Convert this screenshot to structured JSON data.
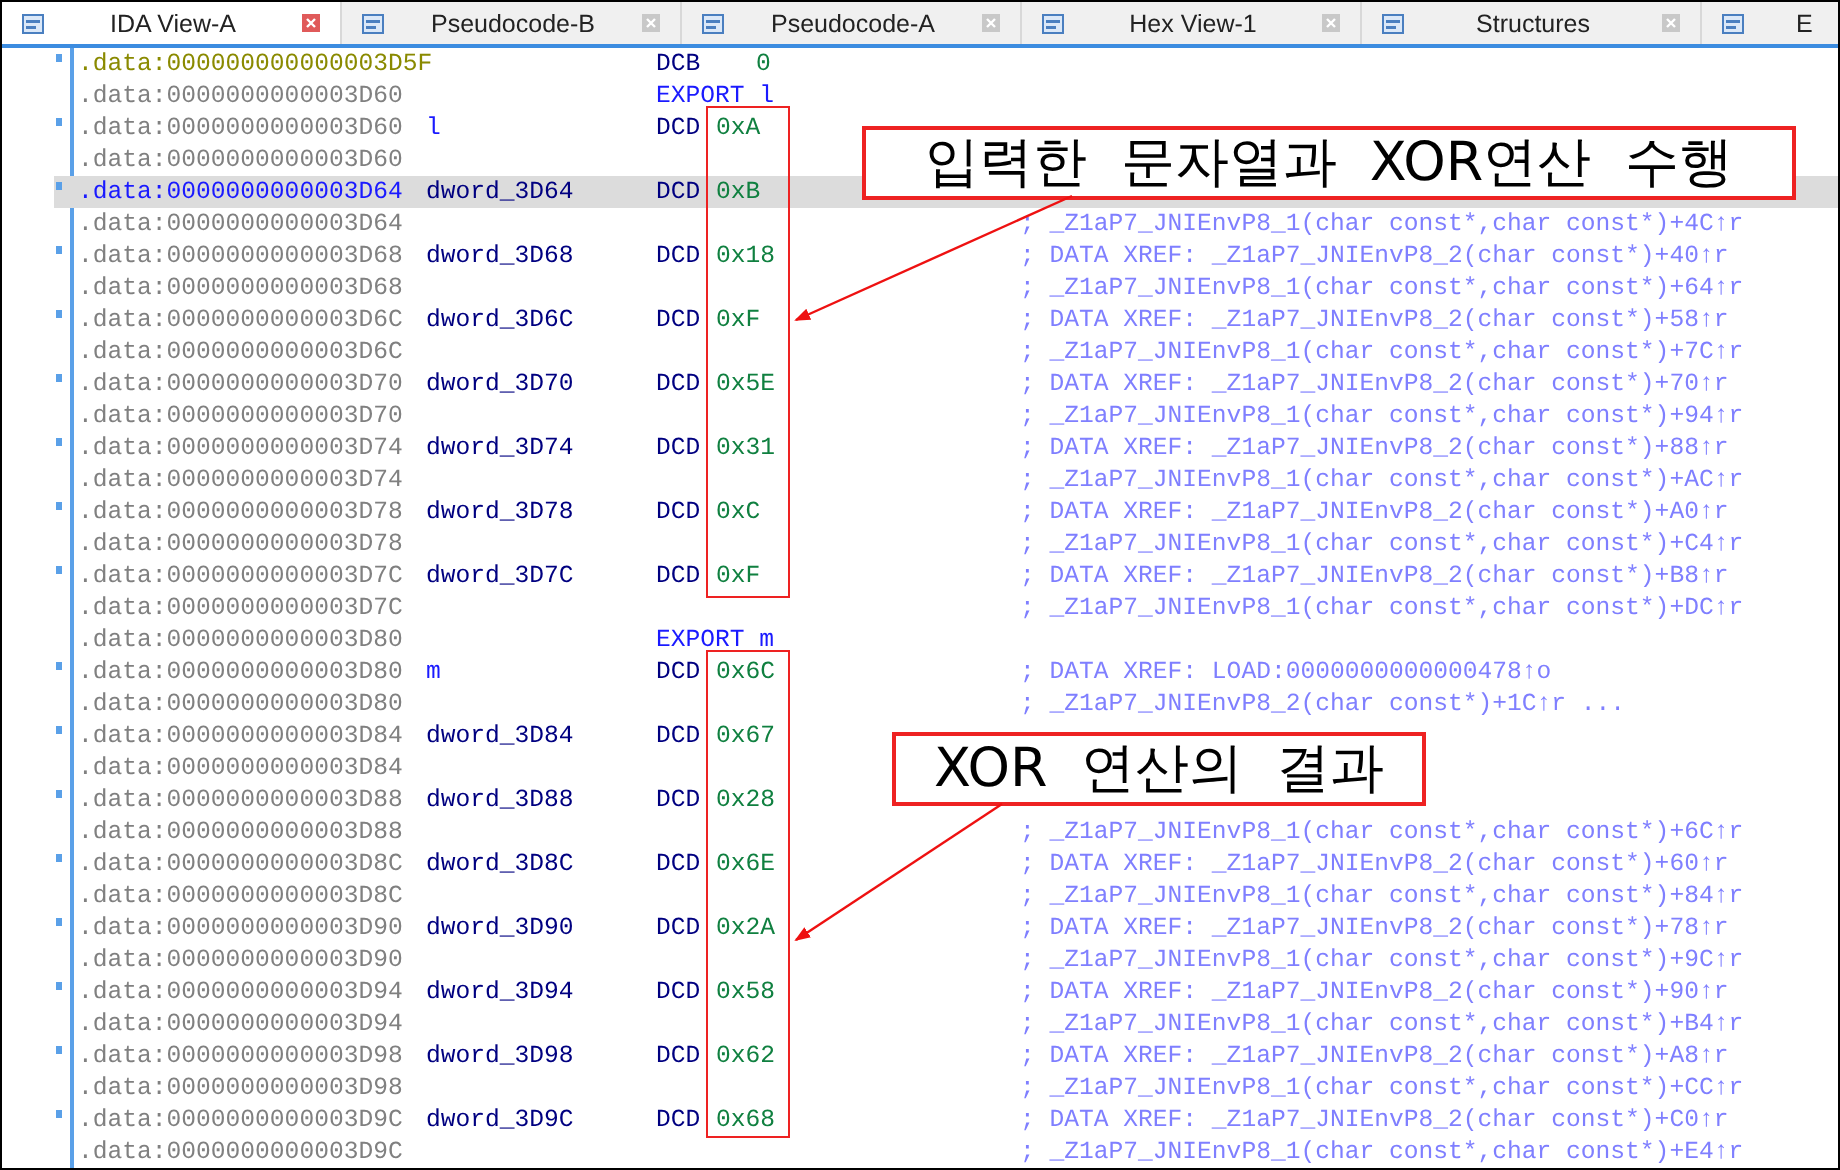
{
  "tabs": [
    {
      "label": "IDA View-A",
      "selected": true,
      "closable": true
    },
    {
      "label": "Pseudocode-B",
      "selected": false,
      "closable": true
    },
    {
      "label": "Pseudocode-A",
      "selected": false,
      "closable": true
    },
    {
      "label": "Hex View-1",
      "selected": false,
      "closable": true
    },
    {
      "label": "Structures",
      "selected": false,
      "closable": true
    },
    {
      "label": "E",
      "selected": false,
      "closable": false
    }
  ],
  "listing": [
    {
      "kind": "data",
      "dot": true,
      "unexplored": true,
      "selected": false,
      "address": ".data:000000000000003D5F",
      "op": "DCB",
      "operand": "0"
    },
    {
      "kind": "export",
      "dot": false,
      "unexplored": false,
      "selected": false,
      "address": ".data:0000000000003D60",
      "op": "EXPORT",
      "operand": "l"
    },
    {
      "kind": "data",
      "dot": true,
      "unexplored": false,
      "selected": false,
      "address": ".data:0000000000003D60",
      "label": "l",
      "public": true,
      "op": "DCD",
      "operand": "0xA"
    },
    {
      "kind": "data",
      "dot": false,
      "unexplored": false,
      "selected": false,
      "address": ".data:0000000000003D60"
    },
    {
      "kind": "data",
      "dot": true,
      "unexplored": false,
      "selected": true,
      "address": ".data:0000000000003D64",
      "label": "dword_3D64",
      "public": false,
      "op": "DCD",
      "operand": "0xB"
    },
    {
      "kind": "data",
      "dot": false,
      "unexplored": false,
      "selected": false,
      "address": ".data:0000000000003D64",
      "comment": "; _Z1aP7_JNIEnvP8_1(char const*,char const*)+4C↑r"
    },
    {
      "kind": "data",
      "dot": true,
      "unexplored": false,
      "selected": false,
      "address": ".data:0000000000003D68",
      "label": "dword_3D68",
      "public": false,
      "op": "DCD",
      "operand": "0x18",
      "comment": "; DATA XREF: _Z1aP7_JNIEnvP8_2(char const*)+40↑r"
    },
    {
      "kind": "data",
      "dot": false,
      "unexplored": false,
      "selected": false,
      "address": ".data:0000000000003D68",
      "comment": "; _Z1aP7_JNIEnvP8_1(char const*,char const*)+64↑r"
    },
    {
      "kind": "data",
      "dot": true,
      "unexplored": false,
      "selected": false,
      "address": ".data:0000000000003D6C",
      "label": "dword_3D6C",
      "public": false,
      "op": "DCD",
      "operand": "0xF",
      "comment": "; DATA XREF: _Z1aP7_JNIEnvP8_2(char const*)+58↑r"
    },
    {
      "kind": "data",
      "dot": false,
      "unexplored": false,
      "selected": false,
      "address": ".data:0000000000003D6C",
      "comment": "; _Z1aP7_JNIEnvP8_1(char const*,char const*)+7C↑r"
    },
    {
      "kind": "data",
      "dot": true,
      "unexplored": false,
      "selected": false,
      "address": ".data:0000000000003D70",
      "label": "dword_3D70",
      "public": false,
      "op": "DCD",
      "operand": "0x5E",
      "comment": "; DATA XREF: _Z1aP7_JNIEnvP8_2(char const*)+70↑r"
    },
    {
      "kind": "data",
      "dot": false,
      "unexplored": false,
      "selected": false,
      "address": ".data:0000000000003D70",
      "comment": "; _Z1aP7_JNIEnvP8_1(char const*,char const*)+94↑r"
    },
    {
      "kind": "data",
      "dot": true,
      "unexplored": false,
      "selected": false,
      "address": ".data:0000000000003D74",
      "label": "dword_3D74",
      "public": false,
      "op": "DCD",
      "operand": "0x31",
      "comment": "; DATA XREF: _Z1aP7_JNIEnvP8_2(char const*)+88↑r"
    },
    {
      "kind": "data",
      "dot": false,
      "unexplored": false,
      "selected": false,
      "address": ".data:0000000000003D74",
      "comment": "; _Z1aP7_JNIEnvP8_1(char const*,char const*)+AC↑r"
    },
    {
      "kind": "data",
      "dot": true,
      "unexplored": false,
      "selected": false,
      "address": ".data:0000000000003D78",
      "label": "dword_3D78",
      "public": false,
      "op": "DCD",
      "operand": "0xC",
      "comment": "; DATA XREF: _Z1aP7_JNIEnvP8_2(char const*)+A0↑r"
    },
    {
      "kind": "data",
      "dot": false,
      "unexplored": false,
      "selected": false,
      "address": ".data:0000000000003D78",
      "comment": "; _Z1aP7_JNIEnvP8_1(char const*,char const*)+C4↑r"
    },
    {
      "kind": "data",
      "dot": true,
      "unexplored": false,
      "selected": false,
      "address": ".data:0000000000003D7C",
      "label": "dword_3D7C",
      "public": false,
      "op": "DCD",
      "operand": "0xF",
      "comment": "; DATA XREF: _Z1aP7_JNIEnvP8_2(char const*)+B8↑r"
    },
    {
      "kind": "data",
      "dot": false,
      "unexplored": false,
      "selected": false,
      "address": ".data:0000000000003D7C",
      "comment": "; _Z1aP7_JNIEnvP8_1(char const*,char const*)+DC↑r"
    },
    {
      "kind": "export",
      "dot": false,
      "unexplored": false,
      "selected": false,
      "address": ".data:0000000000003D80",
      "op": "EXPORT",
      "operand": "m"
    },
    {
      "kind": "data",
      "dot": true,
      "unexplored": false,
      "selected": false,
      "address": ".data:0000000000003D80",
      "label": "m",
      "public": true,
      "op": "DCD",
      "operand": "0x6C",
      "comment": "; DATA XREF: LOAD:0000000000000478↑o"
    },
    {
      "kind": "data",
      "dot": false,
      "unexplored": false,
      "selected": false,
      "address": ".data:0000000000003D80",
      "comment": "; _Z1aP7_JNIEnvP8_2(char const*)+1C↑r ..."
    },
    {
      "kind": "data",
      "dot": true,
      "unexplored": false,
      "selected": false,
      "address": ".data:0000000000003D84",
      "label": "dword_3D84",
      "public": false,
      "op": "DCD",
      "operand": "0x67"
    },
    {
      "kind": "data",
      "dot": false,
      "unexplored": false,
      "selected": false,
      "address": ".data:0000000000003D84"
    },
    {
      "kind": "data",
      "dot": true,
      "unexplored": false,
      "selected": false,
      "address": ".data:0000000000003D88",
      "label": "dword_3D88",
      "public": false,
      "op": "DCD",
      "operand": "0x28"
    },
    {
      "kind": "data",
      "dot": false,
      "unexplored": false,
      "selected": false,
      "address": ".data:0000000000003D88",
      "comment": "; _Z1aP7_JNIEnvP8_1(char const*,char const*)+6C↑r"
    },
    {
      "kind": "data",
      "dot": true,
      "unexplored": false,
      "selected": false,
      "address": ".data:0000000000003D8C",
      "label": "dword_3D8C",
      "public": false,
      "op": "DCD",
      "operand": "0x6E",
      "comment": "; DATA XREF: _Z1aP7_JNIEnvP8_2(char const*)+60↑r"
    },
    {
      "kind": "data",
      "dot": false,
      "unexplored": false,
      "selected": false,
      "address": ".data:0000000000003D8C",
      "comment": "; _Z1aP7_JNIEnvP8_1(char const*,char const*)+84↑r"
    },
    {
      "kind": "data",
      "dot": true,
      "unexplored": false,
      "selected": false,
      "address": ".data:0000000000003D90",
      "label": "dword_3D90",
      "public": false,
      "op": "DCD",
      "operand": "0x2A",
      "comment": "; DATA XREF: _Z1aP7_JNIEnvP8_2(char const*)+78↑r"
    },
    {
      "kind": "data",
      "dot": false,
      "unexplored": false,
      "selected": false,
      "address": ".data:0000000000003D90",
      "comment": "; _Z1aP7_JNIEnvP8_1(char const*,char const*)+9C↑r"
    },
    {
      "kind": "data",
      "dot": true,
      "unexplored": false,
      "selected": false,
      "address": ".data:0000000000003D94",
      "label": "dword_3D94",
      "public": false,
      "op": "DCD",
      "operand": "0x58",
      "comment": "; DATA XREF: _Z1aP7_JNIEnvP8_2(char const*)+90↑r"
    },
    {
      "kind": "data",
      "dot": false,
      "unexplored": false,
      "selected": false,
      "address": ".data:0000000000003D94",
      "comment": "; _Z1aP7_JNIEnvP8_1(char const*,char const*)+B4↑r"
    },
    {
      "kind": "data",
      "dot": true,
      "unexplored": false,
      "selected": false,
      "address": ".data:0000000000003D98",
      "label": "dword_3D98",
      "public": false,
      "op": "DCD",
      "operand": "0x62",
      "comment": "; DATA XREF: _Z1aP7_JNIEnvP8_2(char const*)+A8↑r"
    },
    {
      "kind": "data",
      "dot": false,
      "unexplored": false,
      "selected": false,
      "address": ".data:0000000000003D98",
      "comment": "; _Z1aP7_JNIEnvP8_1(char const*,char const*)+CC↑r"
    },
    {
      "kind": "data",
      "dot": true,
      "unexplored": false,
      "selected": false,
      "address": ".data:0000000000003D9C",
      "label": "dword_3D9C",
      "public": false,
      "op": "DCD",
      "operand": "0x68",
      "comment": "; DATA XREF: _Z1aP7_JNIEnvP8_2(char const*)+C0↑r"
    },
    {
      "kind": "data",
      "dot": false,
      "unexplored": false,
      "selected": false,
      "address": ".data:0000000000003D9C",
      "comment": "; _Z1aP7_JNIEnvP8_1(char const*,char const*)+E4↑r"
    }
  ],
  "annotations": [
    {
      "text": "입력한 문자열과 XOR연산 수행"
    },
    {
      "text": "XOR 연산의 결과"
    }
  ]
}
